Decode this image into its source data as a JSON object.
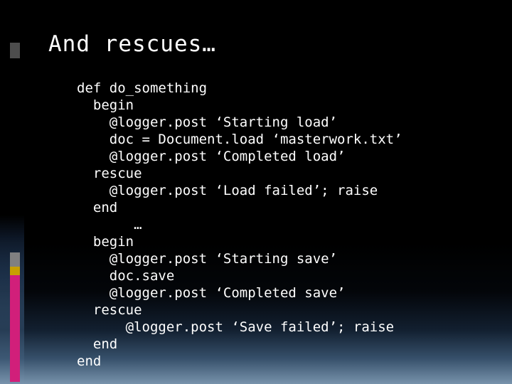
{
  "slide": {
    "title": "And rescues…",
    "background_color": "#000000",
    "text_color": "#ffffff",
    "accent_colors": {
      "grey": "#808080",
      "yellow": "#c8a000",
      "magenta": "#d11f7a",
      "dark_grey": "#4d4d4d"
    },
    "code_lines": [
      "def do_something",
      "  begin",
      "    @logger.post ‘Starting load’",
      "    doc = Document.load ‘masterwork.txt’",
      "    @logger.post ‘Completed load’",
      "  rescue",
      "    @logger.post ‘Load failed’; raise",
      "  end",
      "       …",
      "  begin",
      "    @logger.post ‘Starting save’",
      "    doc.save",
      "    @logger.post ‘Completed save’",
      "  rescue",
      "      @logger.post ‘Save failed’; raise",
      "  end",
      "end"
    ]
  }
}
